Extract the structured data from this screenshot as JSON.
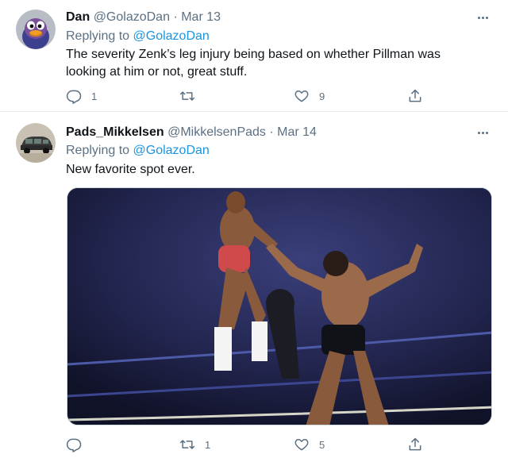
{
  "tweets": [
    {
      "name": "Dan",
      "handle": "@GolazoDan",
      "separator": "·",
      "date": "Mar 13",
      "replying_prefix": "Replying to",
      "replying_to": "@GolazoDan",
      "text": "The severity Zenk’s leg injury being based on whether Pillman was looking at him or not, great stuff.",
      "replies": "1",
      "retweets": "",
      "likes": "9",
      "avatar_icon": "duck-character-avatar"
    },
    {
      "name": "Pads_Mikkelsen",
      "handle": "@MikkelsenPads",
      "separator": "·",
      "date": "Mar 14",
      "replying_prefix": "Replying to",
      "replying_to": "@GolazoDan",
      "text": "New favorite spot ever.",
      "replies": "",
      "retweets": "1",
      "likes": "5",
      "avatar_icon": "car-avatar",
      "media": "wrestling-gif"
    }
  ],
  "icons": {
    "reply": "reply-icon",
    "retweet": "retweet-icon",
    "like": "heart-icon",
    "share": "share-icon",
    "more": "more-icon"
  },
  "colors": {
    "link": "#1b95e0",
    "secondary_text": "#5b7083",
    "divider": "#e6ecf0"
  }
}
